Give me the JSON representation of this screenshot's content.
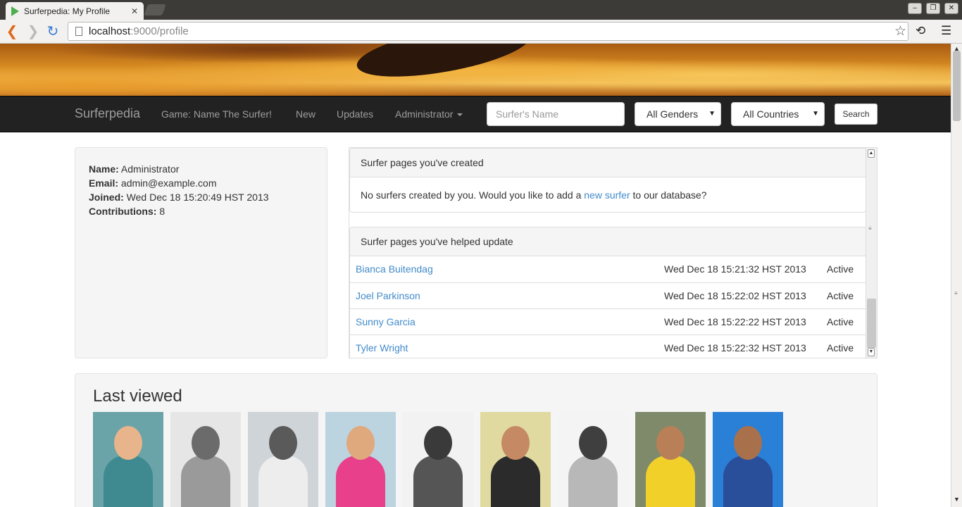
{
  "browser": {
    "tab_title": "Surferpedia: My Profile",
    "url_host": "localhost",
    "url_rest": ":9000/profile"
  },
  "navbar": {
    "brand": "Surferpedia",
    "links": [
      "Game: Name The Surfer!",
      "New",
      "Updates",
      "Administrator"
    ],
    "search_placeholder": "Surfer's Name",
    "gender_select": "All Genders",
    "country_select": "All Countries",
    "search_button": "Search"
  },
  "profile": {
    "name_label": "Name:",
    "name": "Administrator",
    "email_label": "Email:",
    "email": "admin@example.com",
    "joined_label": "Joined:",
    "joined": "Wed Dec 18 15:20:49 HST 2013",
    "contrib_label": "Contributions:",
    "contributions": "8"
  },
  "created_panel": {
    "heading": "Surfer pages you've created",
    "text_before": "No surfers created by you. Would you like to add a",
    "link": "new surfer",
    "text_after": "to our database?"
  },
  "updated_panel": {
    "heading": "Surfer pages you've helped update",
    "rows": [
      {
        "name": "Bianca Buitendag",
        "date": "Wed Dec 18 15:21:32 HST 2013",
        "status": "Active"
      },
      {
        "name": "Joel Parkinson",
        "date": "Wed Dec 18 15:22:02 HST 2013",
        "status": "Active"
      },
      {
        "name": "Sunny Garcia",
        "date": "Wed Dec 18 15:22:22 HST 2013",
        "status": "Active"
      },
      {
        "name": "Tyler Wright",
        "date": "Wed Dec 18 15:22:32 HST 2013",
        "status": "Active"
      }
    ]
  },
  "last_viewed": {
    "title": "Last viewed",
    "thumbs": [
      {
        "bg": "#6aa3a8",
        "skin": "#e8b48c",
        "shirt": "#3f8a90"
      },
      {
        "bg": "#e6e6e6",
        "skin": "#6b6b6b",
        "shirt": "#9a9a9a"
      },
      {
        "bg": "#cfd4d8",
        "skin": "#5a5a5a",
        "shirt": "#ededed"
      },
      {
        "bg": "#bcd3e0",
        "skin": "#e0a87d",
        "shirt": "#e8408a"
      },
      {
        "bg": "#f2f2f2",
        "skin": "#3a3a3a",
        "shirt": "#555555"
      },
      {
        "bg": "#e0d9a0",
        "skin": "#c58a63",
        "shirt": "#2b2b2b"
      },
      {
        "bg": "#f4f4f4",
        "skin": "#3f3f3f",
        "shirt": "#b8b8b8"
      },
      {
        "bg": "#7e8a6a",
        "skin": "#b98058",
        "shirt": "#f1d02a"
      },
      {
        "bg": "#2a7fd6",
        "skin": "#a8714c",
        "shirt": "#2a4f9a"
      }
    ]
  }
}
